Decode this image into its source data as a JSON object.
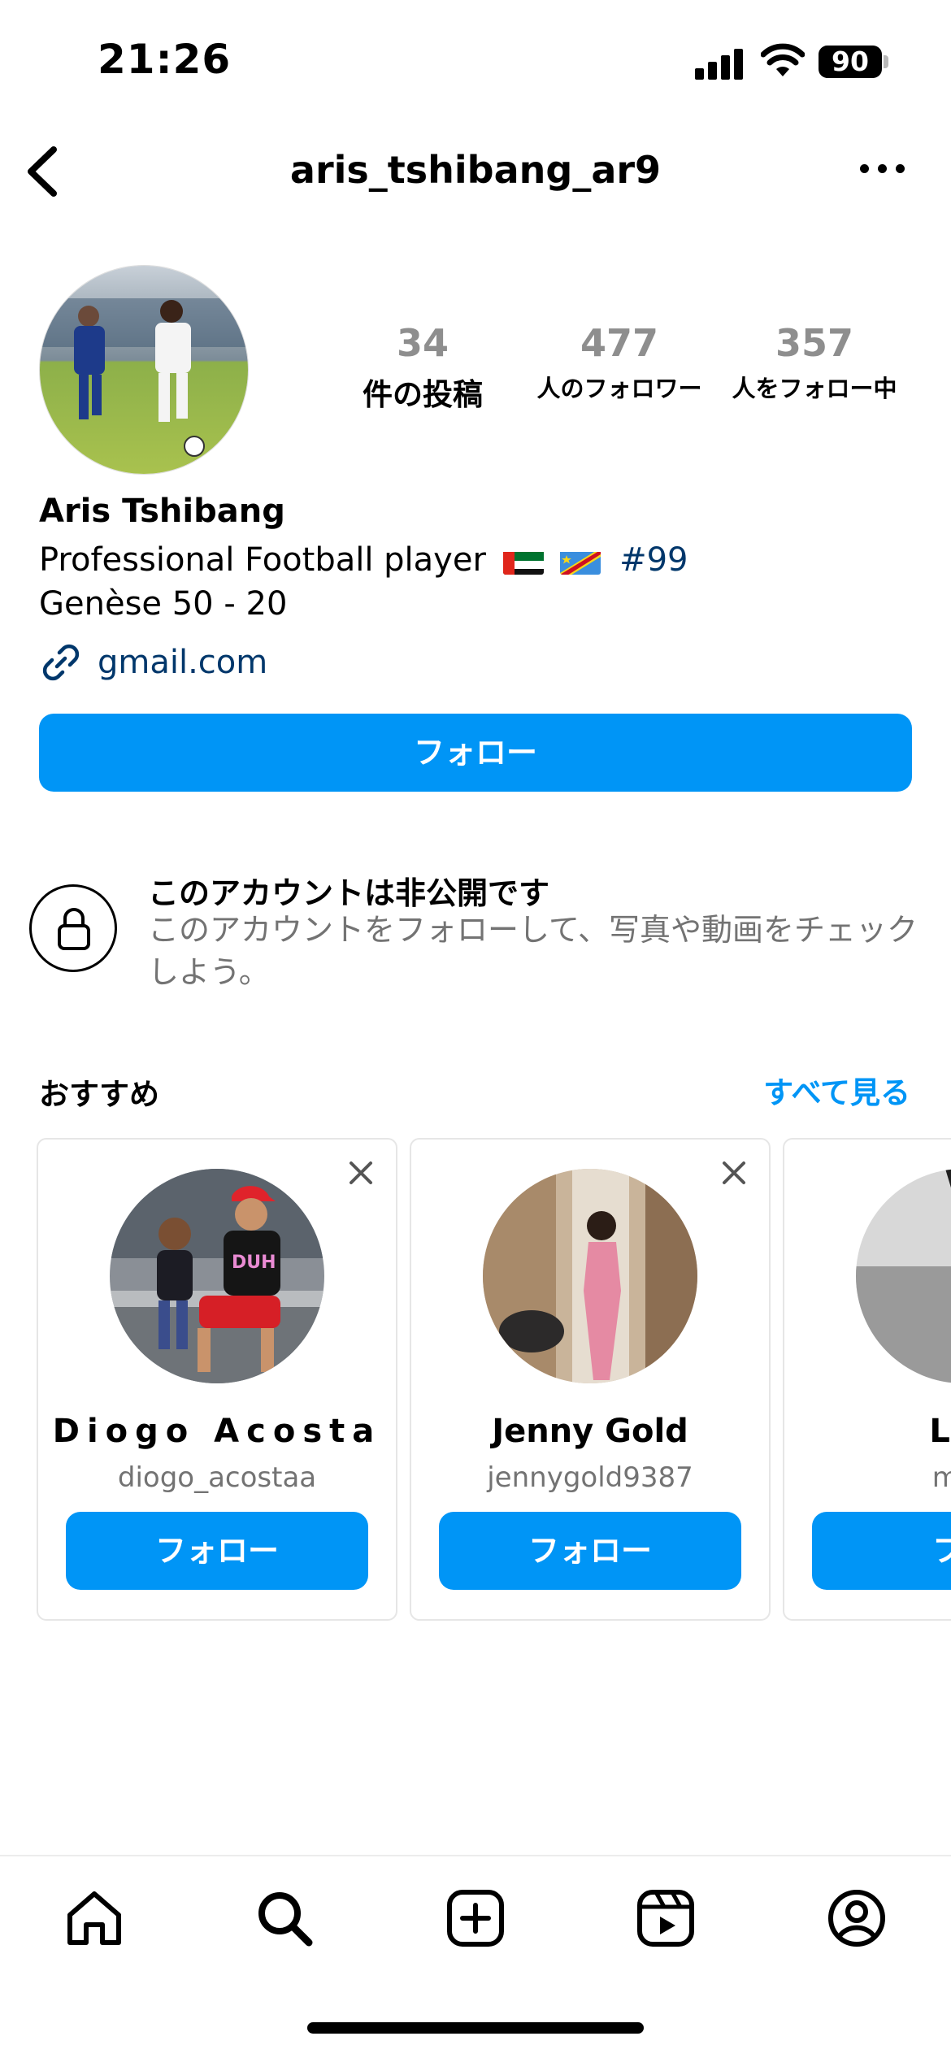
{
  "status_bar": {
    "time": "21:26",
    "battery": "90"
  },
  "header": {
    "username": "aris_tshibang_ar9"
  },
  "profile": {
    "stats": {
      "posts": {
        "value": "34",
        "label": "件の投稿"
      },
      "followers": {
        "value": "477",
        "label": "人のフォロワー"
      },
      "following": {
        "value": "357",
        "label": "人をフォロー中"
      }
    },
    "display_name": "Aris Tshibang",
    "bio_line1": "Professional Football player",
    "bio_hashtag": "#99",
    "bio_line2": "Genèse 50 - 20",
    "link": "gmail.com",
    "follow_button": "フォロー"
  },
  "private_notice": {
    "title": "このアカウントは非公開です",
    "description": "このアカウントをフォローして、写真や動画をチェックしよう。"
  },
  "suggestions": {
    "title": "おすすめ",
    "see_all": "すべて見る",
    "cards": [
      {
        "name": "Diogo Acosta",
        "handle": "diogo_acostaa",
        "button": "フォロー"
      },
      {
        "name": "Jenny Gold",
        "handle": "jennygold9387",
        "button": "フォロー"
      },
      {
        "name": "Lady",
        "handle": "mrs_c",
        "button": "フォ"
      }
    ]
  },
  "tab_bar": {
    "icons": [
      "home-icon",
      "search-icon",
      "create-icon",
      "reels-icon",
      "profile-icon"
    ]
  },
  "colors": {
    "accent": "#0095f6",
    "link": "#00376b",
    "secondary_text": "#737373"
  }
}
